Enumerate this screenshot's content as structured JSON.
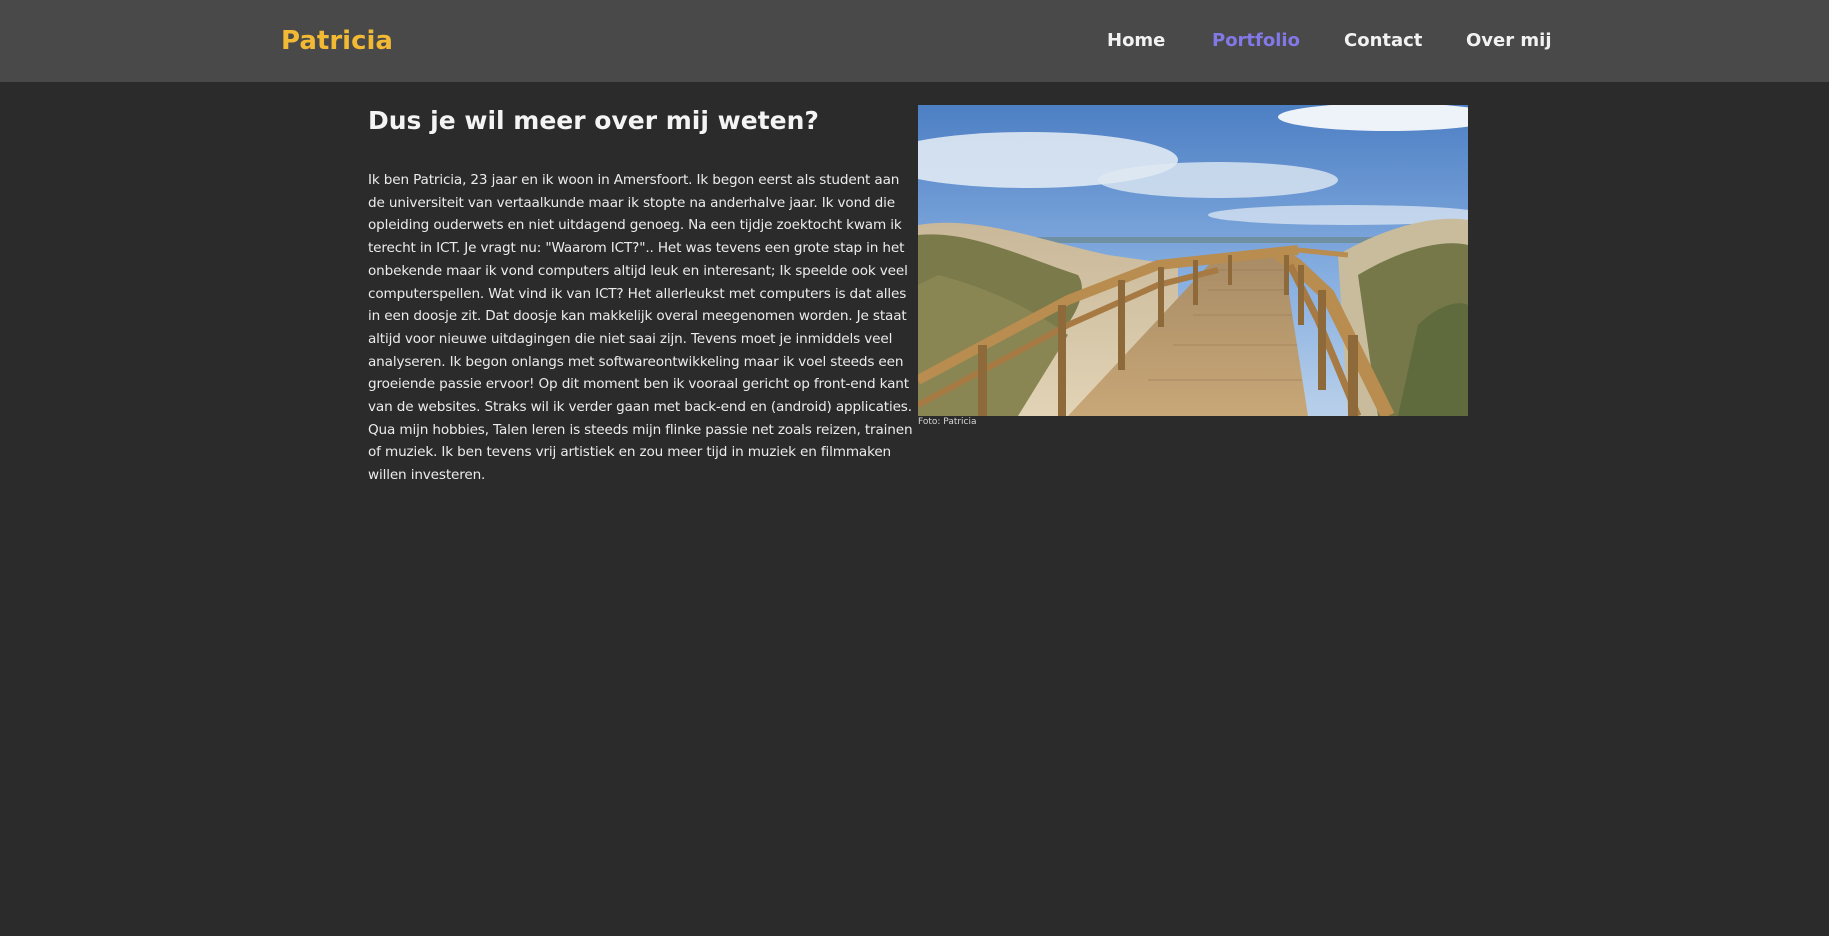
{
  "nav": {
    "brand": "Patricia",
    "links": [
      {
        "label": "Home",
        "active": false
      },
      {
        "label": "Portfolio",
        "active": true
      },
      {
        "label": "Contact",
        "active": false
      },
      {
        "label": "Over mij",
        "active": false
      }
    ]
  },
  "main": {
    "heading": "Dus je wil meer over mij weten?",
    "paragraphs": [
      "Ik ben Patricia, 23 jaar en ik woon in Amersfoort. Ik begon eerst als student aan de universiteit van vertaalkunde maar ik stopte na anderhalve jaar. Ik vond die opleiding ouderwets en niet uitdagend genoeg. Na een tijdje zoektocht kwam ik terecht in ICT. Je vragt nu: \"Waarom ICT?\".. Het was tevens een grote stap in het onbekende maar ik vond computers altijd leuk en interesant; Ik speelde ook veel computerspellen. Wat vind ik van ICT? Het allerleukst met computers is dat alles in een doosje zit. Dat doosje kan makkelijk overal meegenomen worden. Je staat altijd voor nieuwe uitdagingen die niet saai zijn. Tevens moet je inmiddels veel analyseren. Ik begon onlangs met softwareontwikkeling maar ik voel steeds een groeiende passie ervoor! Op dit moment ben ik vooraal gericht op front-end kant van de websites. Straks wil ik verder gaan met back-end en (android) applicaties.",
      "Qua mijn hobbies, Talen leren is steeds mijn flinke passie net zoals reizen, trainen of muziek. Ik ben tevens vrij artistiek en zou meer tijd in muziek en filmmaken willen investeren."
    ],
    "photo_caption": "Foto: Patricia"
  },
  "colors": {
    "page_bg": "#2b2b2b",
    "navbar_bg": "#494949",
    "brand": "#f1b934",
    "nav_active": "#8278e6",
    "nav_text": "#f2f2f2"
  }
}
